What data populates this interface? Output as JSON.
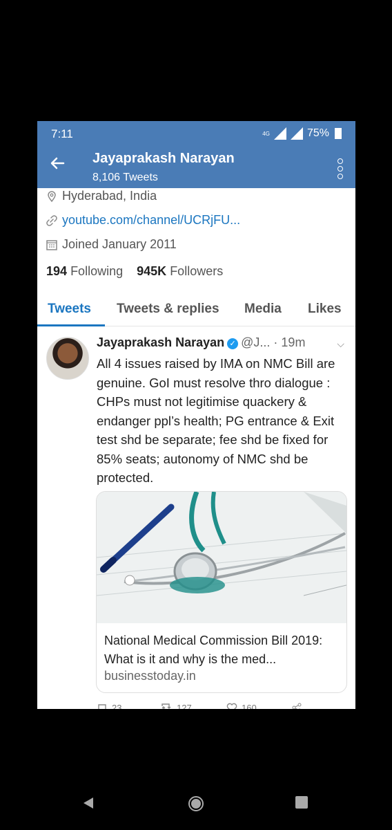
{
  "status": {
    "time": "7:11",
    "battery": "75%",
    "network": "4G"
  },
  "header": {
    "title": "Jayaprakash Narayan",
    "tweet_count": "8,106 Tweets"
  },
  "profile": {
    "location": "Hyderabad, India",
    "website": "youtube.com/channel/UCRjFU...",
    "joined": "Joined January 2011",
    "following_count": "194",
    "following_label": "Following",
    "followers_count": "945K",
    "followers_label": "Followers"
  },
  "tabs": [
    "Tweets",
    "Tweets & replies",
    "Media",
    "Likes"
  ],
  "tweet": {
    "author": "Jayaprakash Narayan",
    "handle": "@J...",
    "time": "· 19m",
    "text": "All 4 issues raised by IMA on NMC Bill are genuine. GoI must resolve thro dialogue : CHPs must not legitimise quackery & endanger ppl’s health; PG entrance & Exit test shd be separate; fee shd be fixed for 85% seats; autonomy of NMC shd be protected.",
    "card": {
      "title": "National Medical Commission Bill 2019: What is it and why is the med...",
      "domain": "businesstoday.in"
    },
    "actions": {
      "replies": "23",
      "retweets": "127",
      "likes": "160"
    }
  },
  "icons": {
    "back": "arrow-left-icon",
    "more": "more-vertical-icon",
    "location": "location-pin-icon",
    "link": "link-icon",
    "calendar": "calendar-icon",
    "verified": "verified-badge-icon"
  },
  "colors": {
    "header": "#4a7cb6",
    "accent": "#1b76c0",
    "verified": "#1d9bf0"
  }
}
